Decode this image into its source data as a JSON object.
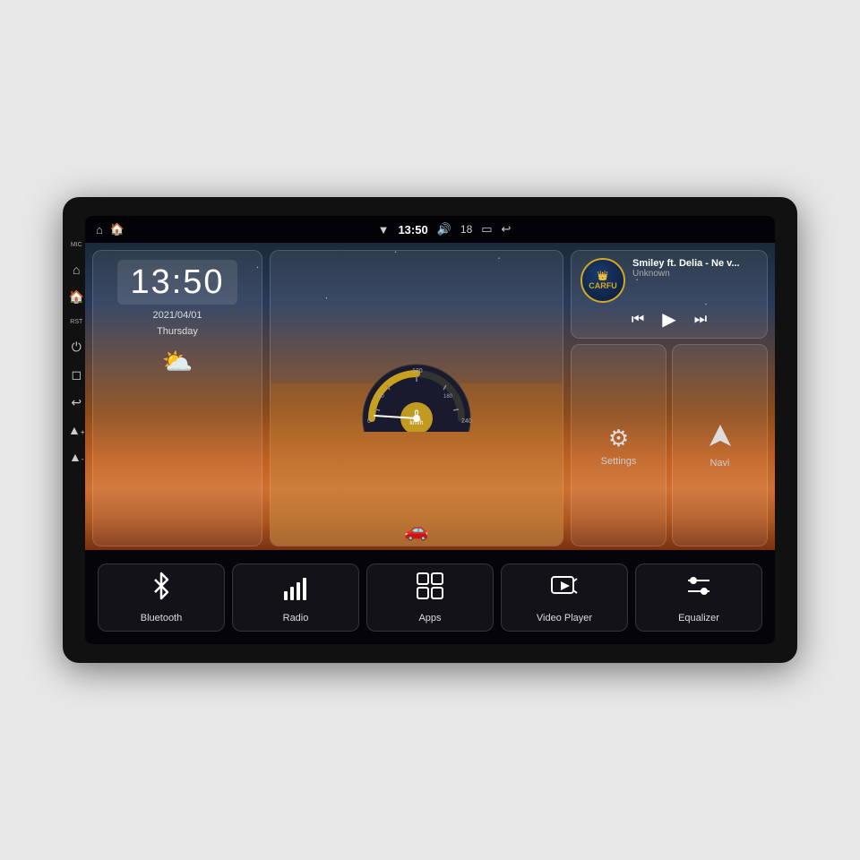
{
  "device": {
    "screen": {
      "status_bar": {
        "left_icons": [
          "home",
          "house"
        ],
        "time": "13:50",
        "wifi_signal": "▼",
        "volume": "🔊",
        "volume_level": "18",
        "battery": "🔋",
        "back": "↩"
      },
      "clock_widget": {
        "time": "13:50",
        "date_line1": "2021/04/01",
        "date_line2": "Thursday",
        "weather_icon": "⛅"
      },
      "music_widget": {
        "title": "Smiley ft. Delia - Ne v...",
        "artist": "Unknown",
        "logo_text": "CARFU",
        "prev_label": "⏮",
        "play_label": "▶",
        "next_label": "⏭"
      },
      "settings_widget": {
        "label": "Settings",
        "icon": "⚙"
      },
      "navi_widget": {
        "label": "Navi",
        "icon": "◭"
      },
      "bottom_nav": [
        {
          "id": "bluetooth",
          "icon": "bluetooth",
          "label": "Bluetooth"
        },
        {
          "id": "radio",
          "icon": "radio",
          "label": "Radio"
        },
        {
          "id": "apps",
          "icon": "apps",
          "label": "Apps"
        },
        {
          "id": "video",
          "icon": "video",
          "label": "Video Player"
        },
        {
          "id": "equalizer",
          "icon": "equalizer",
          "label": "Equalizer"
        }
      ]
    },
    "side_labels": {
      "mic": "MIC",
      "rst": "RST"
    }
  }
}
